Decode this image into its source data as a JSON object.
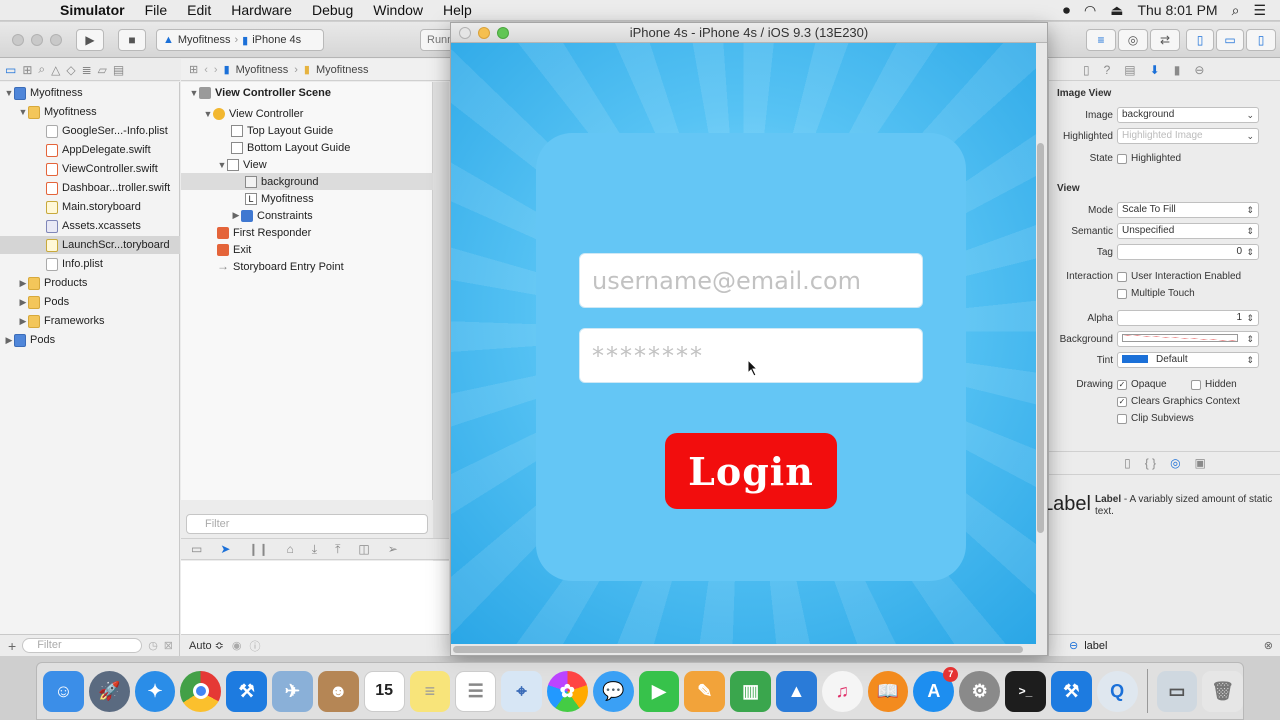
{
  "menubar": {
    "app_name": "Simulator",
    "menus": [
      "File",
      "Edit",
      "Hardware",
      "Debug",
      "Window",
      "Help"
    ],
    "clock": "Thu 8:01 PM"
  },
  "toolbar": {
    "scheme_project": "Myofitness",
    "scheme_device": "iPhone 4s",
    "status_text": "Runni"
  },
  "navigator": {
    "items": [
      {
        "label": "Myofitness",
        "icon": "project-icon"
      },
      {
        "label": "Myofitness",
        "icon": "folder-icon"
      },
      {
        "label": "GoogleSer...-Info.plist",
        "icon": "plist-icon"
      },
      {
        "label": "AppDelegate.swift",
        "icon": "swift-icon"
      },
      {
        "label": "ViewController.swift",
        "icon": "swift-icon"
      },
      {
        "label": "Dashboar...troller.swift",
        "icon": "swift-icon"
      },
      {
        "label": "Main.storyboard",
        "icon": "storyboard-icon"
      },
      {
        "label": "Assets.xcassets",
        "icon": "assets-icon"
      },
      {
        "label": "LaunchScr...toryboard",
        "icon": "storyboard-icon"
      },
      {
        "label": "Info.plist",
        "icon": "plist-icon"
      },
      {
        "label": "Products",
        "icon": "folder-icon"
      },
      {
        "label": "Pods",
        "icon": "folder-icon"
      },
      {
        "label": "Frameworks",
        "icon": "folder-icon"
      },
      {
        "label": "Pods",
        "icon": "project-icon"
      }
    ],
    "filter_placeholder": "Filter"
  },
  "jumpbar": {
    "crumbs": [
      "Myofitness",
      "Myofitness"
    ]
  },
  "outline": {
    "items": [
      {
        "label": "View Controller Scene"
      },
      {
        "label": "View Controller"
      },
      {
        "label": "Top Layout Guide"
      },
      {
        "label": "Bottom Layout Guide"
      },
      {
        "label": "View"
      },
      {
        "label": "background"
      },
      {
        "label": "Myofitness"
      },
      {
        "label": "Constraints"
      },
      {
        "label": "First Responder"
      },
      {
        "label": "Exit"
      },
      {
        "label": "Storyboard Entry Point"
      }
    ],
    "filter_placeholder": "Filter"
  },
  "debug": {
    "auto_label": "Auto ≎"
  },
  "simulator": {
    "title": "iPhone 4s - iPhone 4s / iOS 9.3 (13E230)",
    "username_placeholder": "username@email.com",
    "password_placeholder": "********",
    "login_label": "Login"
  },
  "inspector": {
    "image_view_section": "Image View",
    "view_section": "View",
    "image_label": "Image",
    "image_value": "background",
    "highlighted_label": "Highlighted",
    "highlighted_placeholder": "Highlighted Image",
    "state_label": "State",
    "state_highlighted": "Highlighted",
    "mode_label": "Mode",
    "mode_value": "Scale To Fill",
    "semantic_label": "Semantic",
    "semantic_value": "Unspecified",
    "tag_label": "Tag",
    "tag_value": "0",
    "interaction_label": "Interaction",
    "user_interaction": "User Interaction Enabled",
    "multiple_touch": "Multiple Touch",
    "alpha_label": "Alpha",
    "alpha_value": "1",
    "background_label": "Background",
    "tint_label": "Tint",
    "tint_value": "Default",
    "drawing_label": "Drawing",
    "opaque": "Opaque",
    "hidden": "Hidden",
    "clears_graphics": "Clears Graphics Context",
    "clip_subviews": "Clip Subviews",
    "library_item_title": "Label",
    "library_item_desc": " - A variably sized amount of static text.",
    "library_item_icon_text": "Label",
    "library_filter_value": "label"
  },
  "dock": {
    "calendar_day": "15",
    "appstore_badge": "7"
  },
  "colors": {
    "login_button": "#f20d0d",
    "accent_blue": "#1b70d8"
  }
}
